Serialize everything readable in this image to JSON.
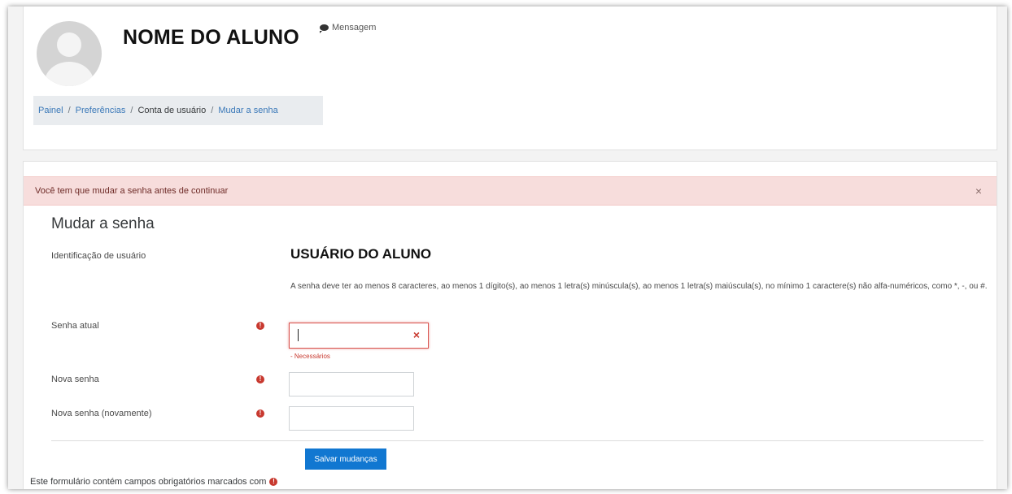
{
  "header": {
    "student_name": "NOME DO ALUNO",
    "message_label": "Mensagem"
  },
  "breadcrumb": {
    "items": [
      "Painel",
      "Preferências",
      "Conta de usuário",
      "Mudar a senha"
    ],
    "separator": "/"
  },
  "alert": {
    "text": "Você tem que mudar a senha antes de continuar",
    "close": "×"
  },
  "form": {
    "title": "Mudar a senha",
    "username_label": "Identificação de usuário",
    "username_value": "USUÁRIO DO ALUNO",
    "password_rules": "A senha deve ter ao menos 8 caracteres, ao menos 1 dígito(s), ao menos 1 letra(s) minúscula(s), ao menos 1 letra(s) maiúscula(s), no mínimo 1 caractere(s) não alfa-numéricos, como *, -, ou #.",
    "current_password_label": "Senha atual",
    "current_password_error": "- Necessários",
    "new_password_label": "Nova senha",
    "new_password_again_label": "Nova senha (novamente)",
    "required_icon": "!",
    "clear_icon": "×",
    "submit_label": "Salvar mudanças",
    "footnote": "Este formulário contém campos obrigatórios marcados com"
  },
  "colors": {
    "primary_button": "#1177d1",
    "alert_background": "#f7dddc",
    "required": "#c8392f",
    "link": "#3a78b8"
  }
}
